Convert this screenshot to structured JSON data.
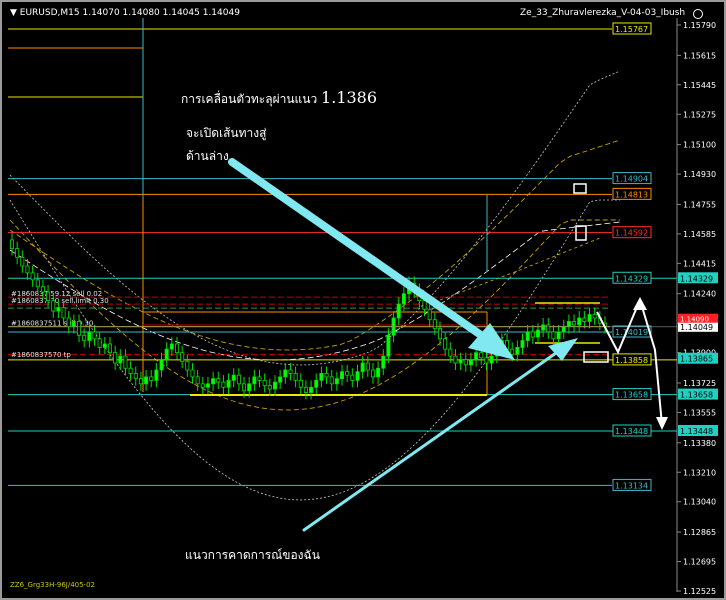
{
  "header": {
    "symbol_info": "▼ EURUSD,M15  1.14070 1.14080 1.14045 1.14049",
    "indicator_name": "Ze_33_Zhuravlerezka_V-04-03_Ibush"
  },
  "annotations": {
    "line1_prefix": "การเคลื่อนตัวทะลุผ่านแนว ",
    "line1_price": "1.1386",
    "line2": "จะเปิดเส้นทางสู่",
    "line3": "ด้านล่าง",
    "bottom": "แนวการคาดการณ์ของฉัน"
  },
  "footer": "ZZ6_Grg33H-96J/405-02",
  "order_labels": [
    {
      "text": "#1860837.59.12 sell 0.02",
      "price": 1.1422
    },
    {
      "text": "#1860837.70 sell limit 0.30",
      "price": 1.1418
    },
    {
      "text": "#1860837511 sell 0.30",
      "price": 1.1405
    },
    {
      "text": "#1860837570 tp",
      "price": 1.1387
    }
  ],
  "chart_data": {
    "type": "candlestick",
    "symbol": "EURUSD",
    "timeframe": "M15",
    "ohlc_header": {
      "open": 1.1407,
      "high": 1.1408,
      "low": 1.14045,
      "close": 1.14049
    },
    "ylim": [
      1.12525,
      1.1588
    ],
    "y_ticks": [
      1.1579,
      1.15615,
      1.15445,
      1.15275,
      1.151,
      1.1493,
      1.14755,
      1.14585,
      1.14415,
      1.1424,
      1.1407,
      1.139,
      1.13725,
      1.13555,
      1.1338,
      1.1321,
      1.1304,
      1.12865,
      1.12695,
      1.12525
    ],
    "level_labels": [
      {
        "price": 1.15767,
        "text": "1.15767",
        "color": "#e8e800"
      },
      {
        "price": 1.14904,
        "text": "1.14904",
        "color": "#3fb7c8"
      },
      {
        "price": 1.14813,
        "text": "1.14813",
        "color": "#ff8c00"
      },
      {
        "price": 1.14592,
        "text": "1.14592",
        "color": "#ff3030"
      },
      {
        "price": 1.14329,
        "text": "1.14329",
        "color": "#20d0c0"
      },
      {
        "price": 1.14019,
        "text": "1.14019",
        "color": "#3fb7c8"
      },
      {
        "price": 1.13858,
        "text": "1.13858",
        "color": "#e8e800"
      },
      {
        "price": 1.13658,
        "text": "1.13658",
        "color": "#20d0c0"
      },
      {
        "price": 1.13448,
        "text": "1.13448",
        "color": "#20d0c0"
      },
      {
        "price": 1.13134,
        "text": "1.13134",
        "color": "#3fb7c8"
      }
    ],
    "current_price": {
      "price": 1.14049,
      "text": "1.14049"
    },
    "red_tag": {
      "price": 1.1409,
      "text": "1.14090"
    },
    "green_tag": {
      "price": 1.13865,
      "text": "1.13865"
    },
    "closes": [
      1.145,
      1.1445,
      1.144,
      1.1436,
      1.1432,
      1.1428,
      1.1425,
      1.142,
      1.1414,
      1.1416,
      1.141,
      1.1405,
      1.1408,
      1.14,
      1.1397,
      1.1402,
      1.1398,
      1.1393,
      1.1395,
      1.139,
      1.1384,
      1.1388,
      1.1381,
      1.1378,
      1.1375,
      1.1372,
      1.1376,
      1.1374,
      1.138,
      1.1386,
      1.1392,
      1.1395,
      1.139,
      1.1385,
      1.138,
      1.1376,
      1.1372,
      1.137,
      1.1372,
      1.1375,
      1.1373,
      1.137,
      1.1374,
      1.1377,
      1.1372,
      1.1368,
      1.1372,
      1.1376,
      1.1374,
      1.1371,
      1.1369,
      1.1373,
      1.1376,
      1.138,
      1.1378,
      1.1374,
      1.137,
      1.1367,
      1.137,
      1.1374,
      1.1378,
      1.1376,
      1.1372,
      1.1375,
      1.1379,
      1.1377,
      1.1374,
      1.1379,
      1.1384,
      1.138,
      1.1376,
      1.1381,
      1.1388,
      1.14,
      1.141,
      1.1418,
      1.1424,
      1.143,
      1.1426,
      1.142,
      1.1415,
      1.1409,
      1.1404,
      1.1398,
      1.1392,
      1.1388,
      1.1384,
      1.1386,
      1.1383,
      1.1386,
      1.139,
      1.1387,
      1.1384,
      1.1388,
      1.1393,
      1.1397,
      1.1392,
      1.1389,
      1.1393,
      1.1397,
      1.1402,
      1.1399,
      1.1403,
      1.1406,
      1.1402,
      1.1398,
      1.1402,
      1.1405,
      1.1408,
      1.1406,
      1.141,
      1.1408,
      1.1412,
      1.141,
      1.1407,
      1.1405
    ]
  }
}
